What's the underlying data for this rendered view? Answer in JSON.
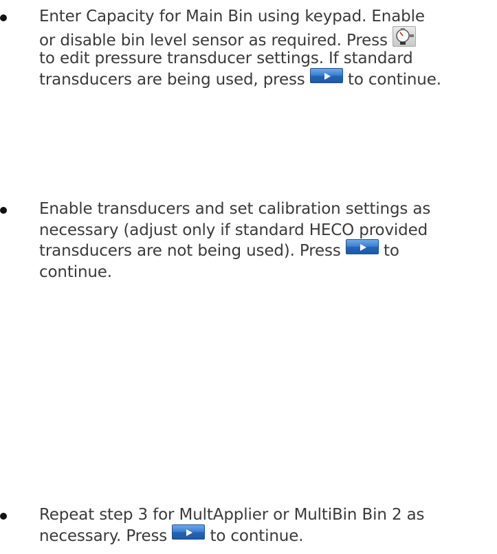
{
  "items": [
    {
      "lines": [
        [
          "Enter Capacity for Main Bin using keypad.  Enable"
        ],
        [
          "or disable bin level sensor as required.  Press ",
          {
            "icon": "gauge-icon"
          }
        ],
        [
          "to edit pressure transducer settings.  If standard"
        ],
        [
          "transducers are being used, press ",
          {
            "icon": "play-icon"
          },
          " to continue."
        ]
      ]
    },
    {
      "lines": [
        [
          "Enable transducers and set calibration settings as"
        ],
        [
          "necessary (adjust only if standard  HECO provided"
        ],
        [
          "transducers are not being used).  Press ",
          {
            "icon": "play-icon"
          },
          " to"
        ],
        [
          "continue."
        ]
      ]
    },
    {
      "lines": [
        [
          "Repeat step 3 for MultApplier or MultiBin Bin 2 as"
        ],
        [
          "necessary.  Press ",
          {
            "icon": "play-icon"
          },
          " to continue."
        ]
      ]
    }
  ]
}
